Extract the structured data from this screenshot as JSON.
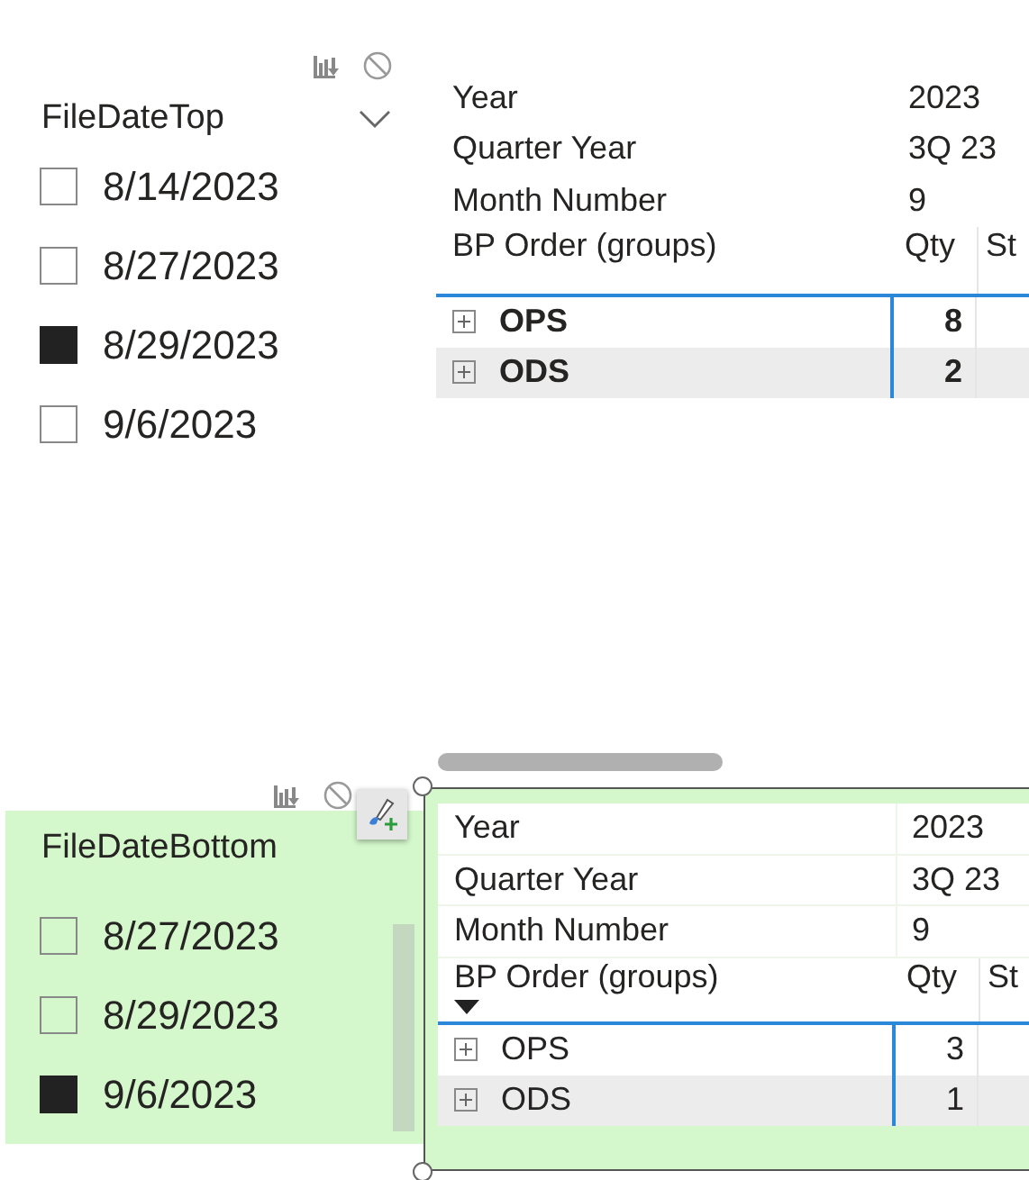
{
  "slicers": [
    {
      "title": "FileDateTop",
      "dropdown": true,
      "highlighted": false,
      "scrollbar": false,
      "items": [
        {
          "label": "8/14/2023",
          "checked": false
        },
        {
          "label": "8/27/2023",
          "checked": false
        },
        {
          "label": "8/29/2023",
          "checked": true
        },
        {
          "label": "9/6/2023",
          "checked": false
        }
      ]
    },
    {
      "title": "FileDateBottom",
      "dropdown": false,
      "highlighted": true,
      "scrollbar": true,
      "items": [
        {
          "label": "8/27/2023",
          "checked": false
        },
        {
          "label": "8/29/2023",
          "checked": false
        },
        {
          "label": "9/6/2023",
          "checked": true
        }
      ]
    }
  ],
  "matrices": [
    {
      "highlighted": false,
      "bold": true,
      "sorted": false,
      "filters": [
        {
          "label": "Year",
          "value": "2023"
        },
        {
          "label": "Quarter Year",
          "value": "3Q 23"
        },
        {
          "label": "Month Number",
          "value": "9"
        }
      ],
      "row_header": "BP Order (groups)",
      "columns": [
        "Qty",
        "St"
      ],
      "rows": [
        {
          "label": "OPS",
          "qty": "8"
        },
        {
          "label": "ODS",
          "qty": "2"
        }
      ]
    },
    {
      "highlighted": true,
      "bold": false,
      "sorted": true,
      "filters": [
        {
          "label": "Year",
          "value": "2023"
        },
        {
          "label": "Quarter Year",
          "value": "3Q 23"
        },
        {
          "label": "Month Number",
          "value": "9"
        }
      ],
      "row_header": "BP Order (groups)",
      "columns": [
        "Qty",
        "St"
      ],
      "rows": [
        {
          "label": "OPS",
          "qty": "3"
        },
        {
          "label": "ODS",
          "qty": "1"
        }
      ]
    }
  ]
}
